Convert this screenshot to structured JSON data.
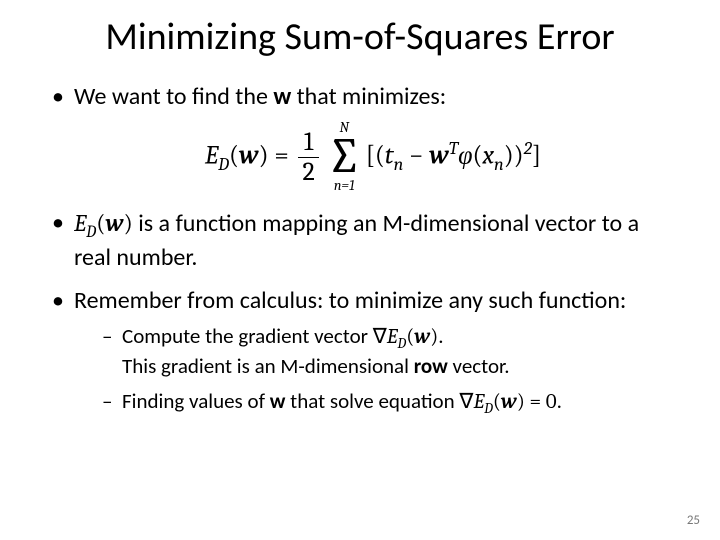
{
  "title": "Minimizing Sum-of-Squares Error",
  "bullets": {
    "b1_prefix": "We want to find the ",
    "b1_bold": "w",
    "b1_suffix": " that minimizes:",
    "b2_suffix": " is a function mapping an M-dimensional vector to a real number.",
    "b3": "Remember from calculus: to minimize any such function:",
    "s1a": "Compute the gradient vector ",
    "s1b": ".",
    "s1c": "This gradient is an M-dimensional ",
    "s1_row": "row",
    "s1d": " vector.",
    "s2a": "Finding values of ",
    "s2_w": "w",
    "s2b": " that solve equation ",
    "s2c": "."
  },
  "math": {
    "E": "E",
    "D": "D",
    "w": "w",
    "eq": " = ",
    "half_num": "1",
    "half_den": "2",
    "N": "N",
    "sigma": "∑",
    "sum_lo": "n=1",
    "lb": "[(",
    "t": "t",
    "n": "n",
    "minus": " − ",
    "T": "T",
    "phi": "φ",
    "x": "x",
    "rp": ")",
    "sq": "2",
    "rb": "]",
    "nabla": "∇",
    "zero": " = 0",
    "lp": "("
  },
  "page": "25"
}
